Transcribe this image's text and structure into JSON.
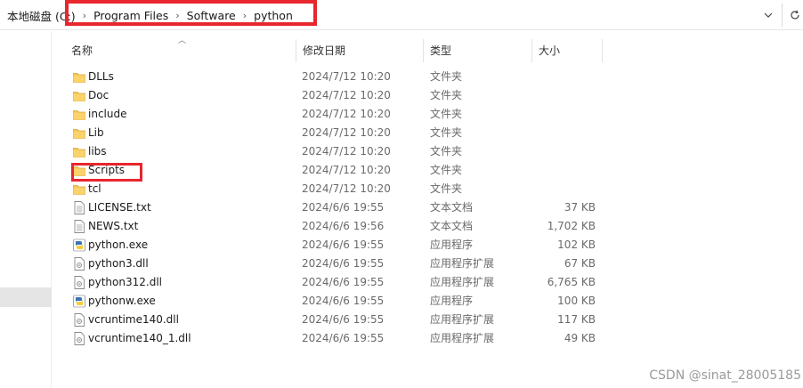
{
  "breadcrumb": {
    "items": [
      "本地磁盘 (C:)",
      "Program Files",
      "Software",
      "python"
    ],
    "separator": "›"
  },
  "address_bar": {
    "dropdown_icon": "chevron-down-icon",
    "refresh_icon": "refresh-icon"
  },
  "columns": {
    "name": "名称",
    "date": "修改日期",
    "type": "类型",
    "size": "大小"
  },
  "files": [
    {
      "name": "DLLs",
      "date": "2024/7/12 10:20",
      "type": "文件夹",
      "size": "",
      "icon": "folder-icon"
    },
    {
      "name": "Doc",
      "date": "2024/7/12 10:20",
      "type": "文件夹",
      "size": "",
      "icon": "folder-icon"
    },
    {
      "name": "include",
      "date": "2024/7/12 10:20",
      "type": "文件夹",
      "size": "",
      "icon": "folder-icon"
    },
    {
      "name": "Lib",
      "date": "2024/7/12 10:20",
      "type": "文件夹",
      "size": "",
      "icon": "folder-icon"
    },
    {
      "name": "libs",
      "date": "2024/7/12 10:20",
      "type": "文件夹",
      "size": "",
      "icon": "folder-icon"
    },
    {
      "name": "Scripts",
      "date": "2024/7/12 10:20",
      "type": "文件夹",
      "size": "",
      "icon": "folder-icon"
    },
    {
      "name": "tcl",
      "date": "2024/7/12 10:20",
      "type": "文件夹",
      "size": "",
      "icon": "folder-icon"
    },
    {
      "name": "LICENSE.txt",
      "date": "2024/6/6 19:55",
      "type": "文本文档",
      "size": "37 KB",
      "icon": "text-file-icon"
    },
    {
      "name": "NEWS.txt",
      "date": "2024/6/6 19:56",
      "type": "文本文档",
      "size": "1,702 KB",
      "icon": "text-file-icon"
    },
    {
      "name": "python.exe",
      "date": "2024/6/6 19:55",
      "type": "应用程序",
      "size": "102 KB",
      "icon": "python-exe-icon"
    },
    {
      "name": "python3.dll",
      "date": "2024/6/6 19:55",
      "type": "应用程序扩展",
      "size": "67 KB",
      "icon": "dll-file-icon"
    },
    {
      "name": "python312.dll",
      "date": "2024/6/6 19:55",
      "type": "应用程序扩展",
      "size": "6,765 KB",
      "icon": "dll-file-icon"
    },
    {
      "name": "pythonw.exe",
      "date": "2024/6/6 19:55",
      "type": "应用程序",
      "size": "100 KB",
      "icon": "python-exe-icon"
    },
    {
      "name": "vcruntime140.dll",
      "date": "2024/6/6 19:55",
      "type": "应用程序扩展",
      "size": "117 KB",
      "icon": "dll-file-icon"
    },
    {
      "name": "vcruntime140_1.dll",
      "date": "2024/6/6 19:55",
      "type": "应用程序扩展",
      "size": "49 KB",
      "icon": "dll-file-icon"
    }
  ],
  "watermark": "CSDN @sinat_28005185",
  "colors": {
    "highlight": "#e8262d",
    "folder": "#f5c64c"
  }
}
